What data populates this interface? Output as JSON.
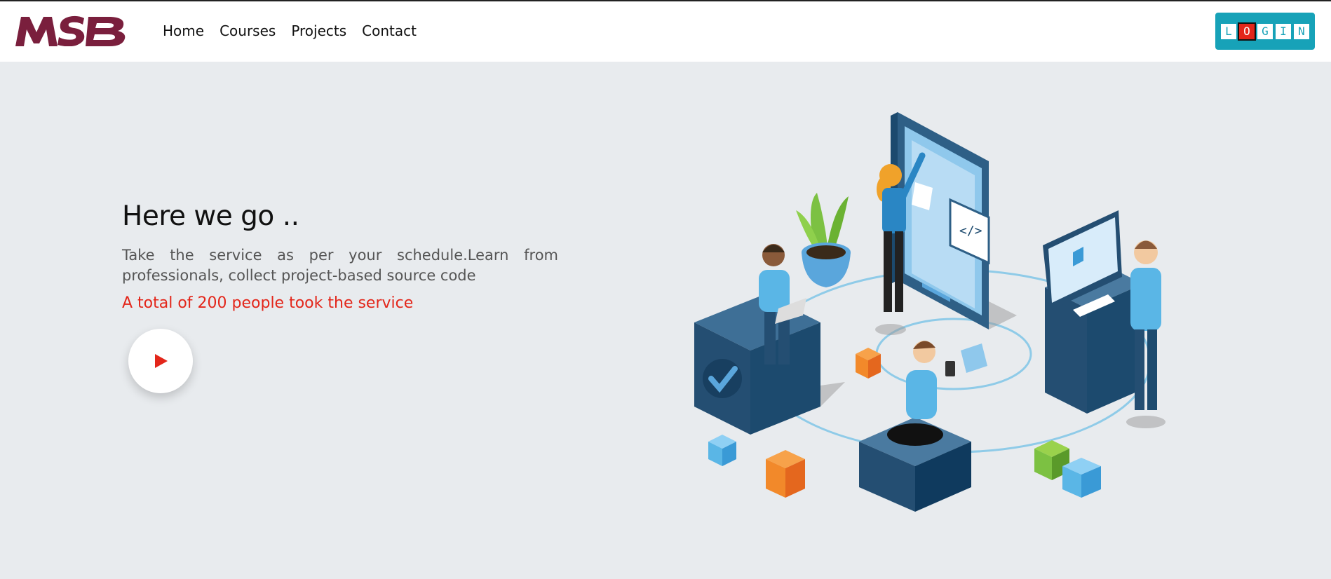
{
  "brand": {
    "logo_text": "MSB",
    "logo_color": "#7a1f3d"
  },
  "nav": {
    "items": [
      {
        "label": "Home"
      },
      {
        "label": "Courses"
      },
      {
        "label": "Projects"
      },
      {
        "label": "Contact"
      }
    ]
  },
  "login": {
    "letters": [
      "L",
      "O",
      "G",
      "I",
      "N"
    ],
    "accent": "#17a2b8",
    "highlight": "#e3261a"
  },
  "hero": {
    "title": "Here we go ..",
    "description": "Take the service as per your schedule.Learn from professionals, collect project-based source code",
    "count_text": "A total of 200 people took the service",
    "play_icon": "play-icon"
  },
  "colors": {
    "background": "#e8ebee",
    "header_bg": "#ffffff",
    "accent_red": "#e3261a"
  }
}
